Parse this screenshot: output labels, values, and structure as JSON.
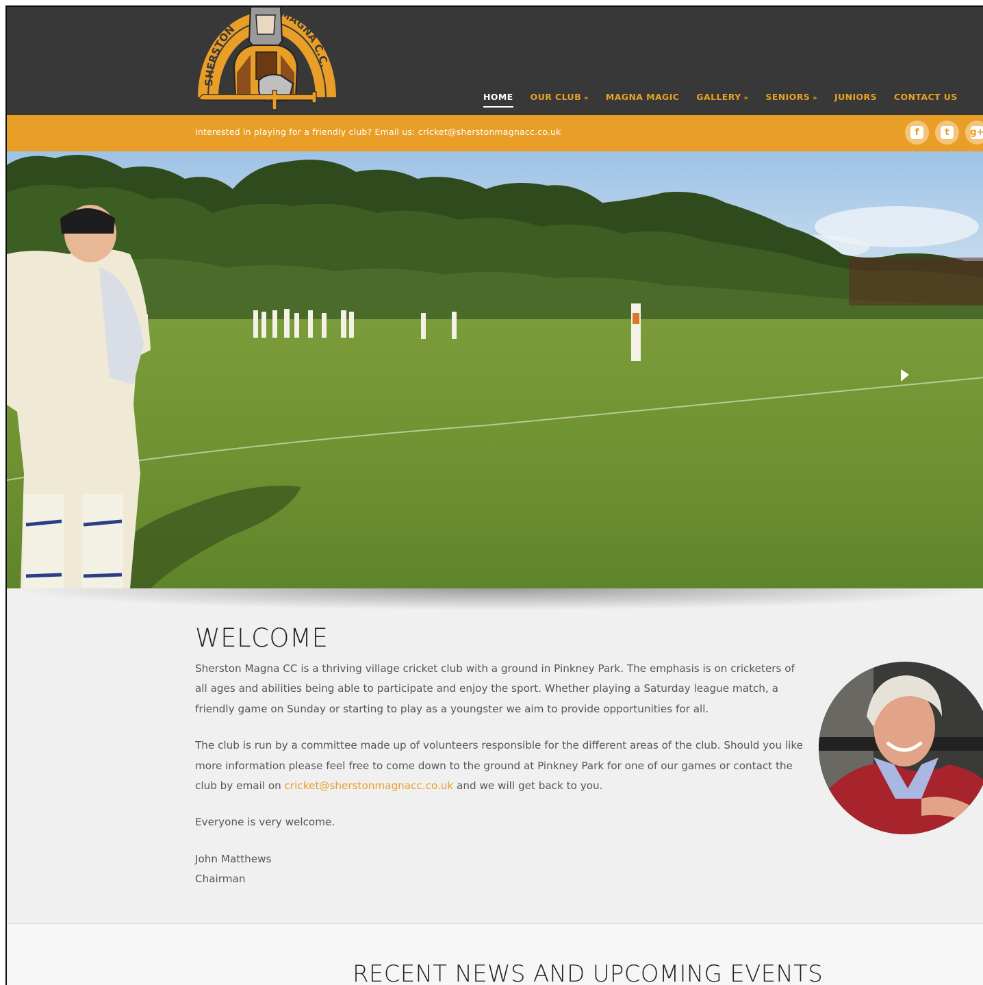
{
  "brand": {
    "logo_text_top_left": "SHERSTON",
    "logo_text_top_right": "MAGNA C.C."
  },
  "nav": {
    "items": [
      {
        "label": "HOME",
        "has_dropdown": false
      },
      {
        "label": "OUR CLUB",
        "has_dropdown": true
      },
      {
        "label": "MAGNA MAGIC",
        "has_dropdown": false
      },
      {
        "label": "GALLERY",
        "has_dropdown": true
      },
      {
        "label": "SENIORS",
        "has_dropdown": true
      },
      {
        "label": "JUNIORS",
        "has_dropdown": false
      },
      {
        "label": "CONTACT US",
        "has_dropdown": false
      }
    ],
    "dropdown_glyph": "»"
  },
  "topbar": {
    "text": "Interested in playing for a friendly club? Email us: cricket@sherstonmagnacc.co.uk",
    "social": [
      {
        "icon": "facebook-icon",
        "glyph": "f"
      },
      {
        "icon": "twitter-icon",
        "glyph": "t"
      },
      {
        "icon": "google-plus-icon",
        "glyph": "g+"
      }
    ]
  },
  "welcome": {
    "title": "WELCOME",
    "p1": "Sherston Magna CC is a thriving village cricket club with a ground in Pinkney Park. The emphasis is on cricketers of all ages and abilities being able to participate and enjoy the sport. Whether playing a Saturday league match, a friendly game on Sunday or starting to play as a youngster we aim to provide opportunities for all.",
    "p2_before": "The club is run by a committee made up of volunteers responsible for the different areas of the club. Should you like more information please feel free to come down to the ground at Pinkney Park for one of our games or contact the club by email on ",
    "p2_link": "cricket@sherstonmagnacc.co.uk",
    "p2_after": " and we will get back to you.",
    "p3": "Everyone is very welcome.",
    "signature_name": "John Matthews",
    "signature_role": "Chairman"
  },
  "news": {
    "title": "RECENT NEWS AND UPCOMING EVENTS"
  },
  "colors": {
    "accent": "#e99e27",
    "header_bg": "#383838",
    "page_bg": "#f0f0f0"
  }
}
